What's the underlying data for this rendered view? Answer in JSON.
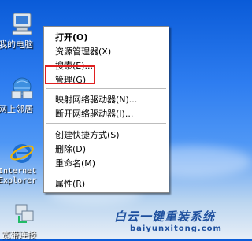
{
  "desktop": {
    "icons": [
      {
        "label": "我的电脑",
        "icon": "my-computer-icon"
      },
      {
        "label": "网上邻居",
        "icon": "network-places-icon"
      },
      {
        "label": "Internet",
        "label2": "Explorer",
        "icon": "internet-explorer-icon"
      },
      {
        "label": "宽带连接",
        "icon": "broadband-connection-icon"
      }
    ]
  },
  "context_menu": {
    "items": [
      {
        "label": "打开(O)",
        "bold": true
      },
      {
        "label": "资源管理器(X)"
      },
      {
        "label": "搜索(E)..."
      },
      {
        "label": "管理(G)"
      },
      {
        "label": "映射网络驱动器(N)..."
      },
      {
        "label": "断开网络驱动器(I)..."
      },
      {
        "label": "创建快捷方式(S)"
      },
      {
        "label": "删除(D)"
      },
      {
        "label": "重命名(M)"
      },
      {
        "label": "属性(R)"
      }
    ]
  },
  "watermark": {
    "line1": "白云一键重装系统",
    "line2": "baiyunxitong.com"
  },
  "colors": {
    "highlight_box": "#e02020",
    "watermark": "#1d4f9e"
  }
}
